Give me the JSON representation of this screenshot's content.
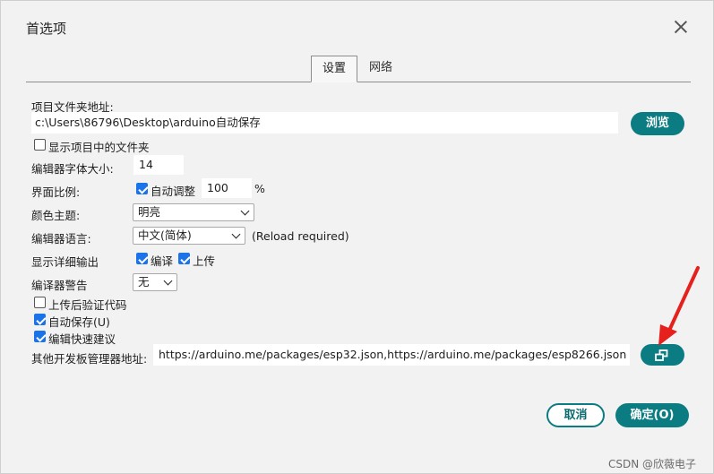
{
  "dialog": {
    "title": "首选项",
    "tabs": [
      {
        "label": "设置"
      },
      {
        "label": "网络"
      }
    ]
  },
  "settings": {
    "sketchbook_label": "项目文件夹地址:",
    "sketchbook_path": "c:\\Users\\86796\\Desktop\\arduino自动保存",
    "browse_label": "浏览",
    "show_files_label": "显示项目中的文件夹",
    "show_files_checked": false,
    "font_size_label": "编辑器字体大小:",
    "font_size_value": "14",
    "scale_label": "界面比例:",
    "auto_scale_label": "自动调整",
    "auto_scale_checked": true,
    "scale_value": "100",
    "scale_unit": "%",
    "theme_label": "颜色主题:",
    "theme_value": "明亮",
    "language_label": "编辑器语言:",
    "language_value": "中文(简体)",
    "reload_note": "(Reload required)",
    "verbose_label": "显示详细输出",
    "verbose_compile_label": "编译",
    "verbose_compile_checked": true,
    "verbose_upload_label": "上传",
    "verbose_upload_checked": true,
    "warnings_label": "编译器警告",
    "warnings_value": "无",
    "verify_label": "上传后验证代码",
    "verify_checked": false,
    "autosave_label": "自动保存(U)",
    "autosave_checked": true,
    "quick_suggest_label": "编辑快速建议",
    "quick_suggest_checked": true,
    "board_urls_label": "其他开发板管理器地址:",
    "board_urls_value": "https://arduino.me/packages/esp32.json,https://arduino.me/packages/esp8266.json"
  },
  "footer": {
    "cancel_label": "取消",
    "ok_label": "确定(O)"
  },
  "watermark": "CSDN @欣薇电子",
  "icons": {
    "open_window": "open-external-icon",
    "close": "close-icon",
    "arrow": "red-arrow-annotation"
  },
  "colors": {
    "accent": "#0b7c82",
    "checkbox": "#1a73e8",
    "annotation": "#e5201d"
  }
}
